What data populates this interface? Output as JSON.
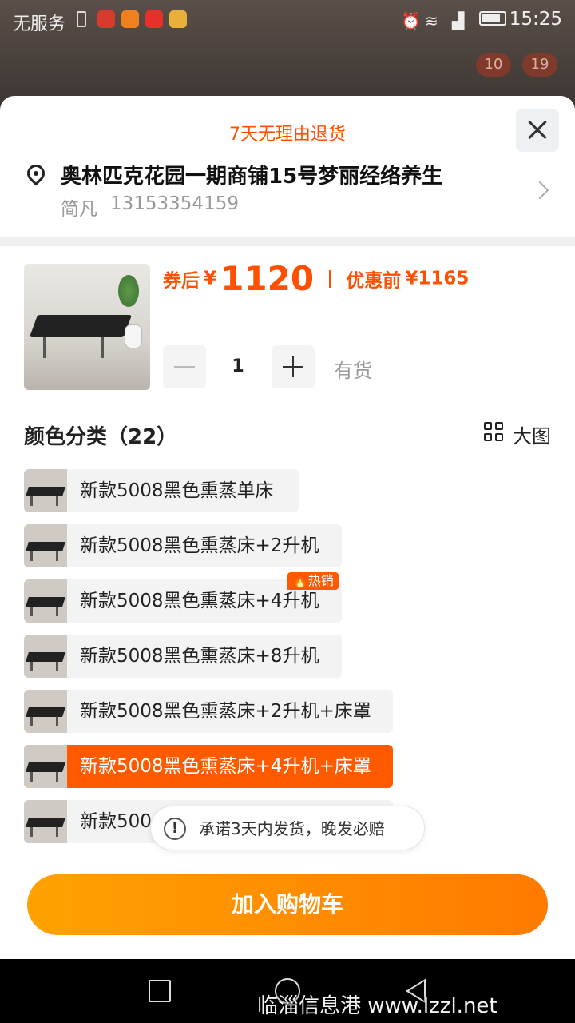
{
  "status_bar": {
    "carrier": "无服务",
    "time": "15:25"
  },
  "background": {
    "badge_1": "10",
    "badge_2": "19"
  },
  "sheet": {
    "return_policy": "7天无理由退货",
    "address": {
      "title": "奥林匹克花园一期商铺15号梦丽经络养生",
      "name": "简凡",
      "phone": "13153354159"
    },
    "price": {
      "coupon_label": "券后",
      "currency": "¥",
      "coupon_price": "1120",
      "orig_label": "优惠前",
      "orig_price": "¥1165"
    },
    "quantity": {
      "value": "1",
      "stock_status": "有货"
    },
    "options_section": {
      "title": "颜色分类（22）",
      "big_view_label": "大图"
    },
    "options": [
      {
        "label": "新款5008黑色熏蒸单床",
        "selected": false
      },
      {
        "label": "新款5008黑色熏蒸床+2升机",
        "selected": false
      },
      {
        "label": "新款5008黑色熏蒸床+4升机",
        "selected": false,
        "badge": "热销"
      },
      {
        "label": "新款5008黑色熏蒸床+8升机",
        "selected": false
      },
      {
        "label": "新款5008黑色熏蒸床+2升机+床罩",
        "selected": false
      },
      {
        "label": "新款5008黑色熏蒸床+4升机+床罩",
        "selected": true
      },
      {
        "label": "新款500",
        "selected": false
      }
    ],
    "hot_badge": "热销",
    "toast": {
      "icon": "!",
      "text": "承诺3天内发货，晚发必赔"
    },
    "add_to_cart_label": "加入购物车"
  },
  "watermark": "临淄信息港 www.lzzl.net",
  "colors": {
    "accent": "#ff5000",
    "selected_option": "#ff5a00",
    "button_gradient_start": "#ffa200",
    "button_gradient_end": "#ff7a00"
  }
}
